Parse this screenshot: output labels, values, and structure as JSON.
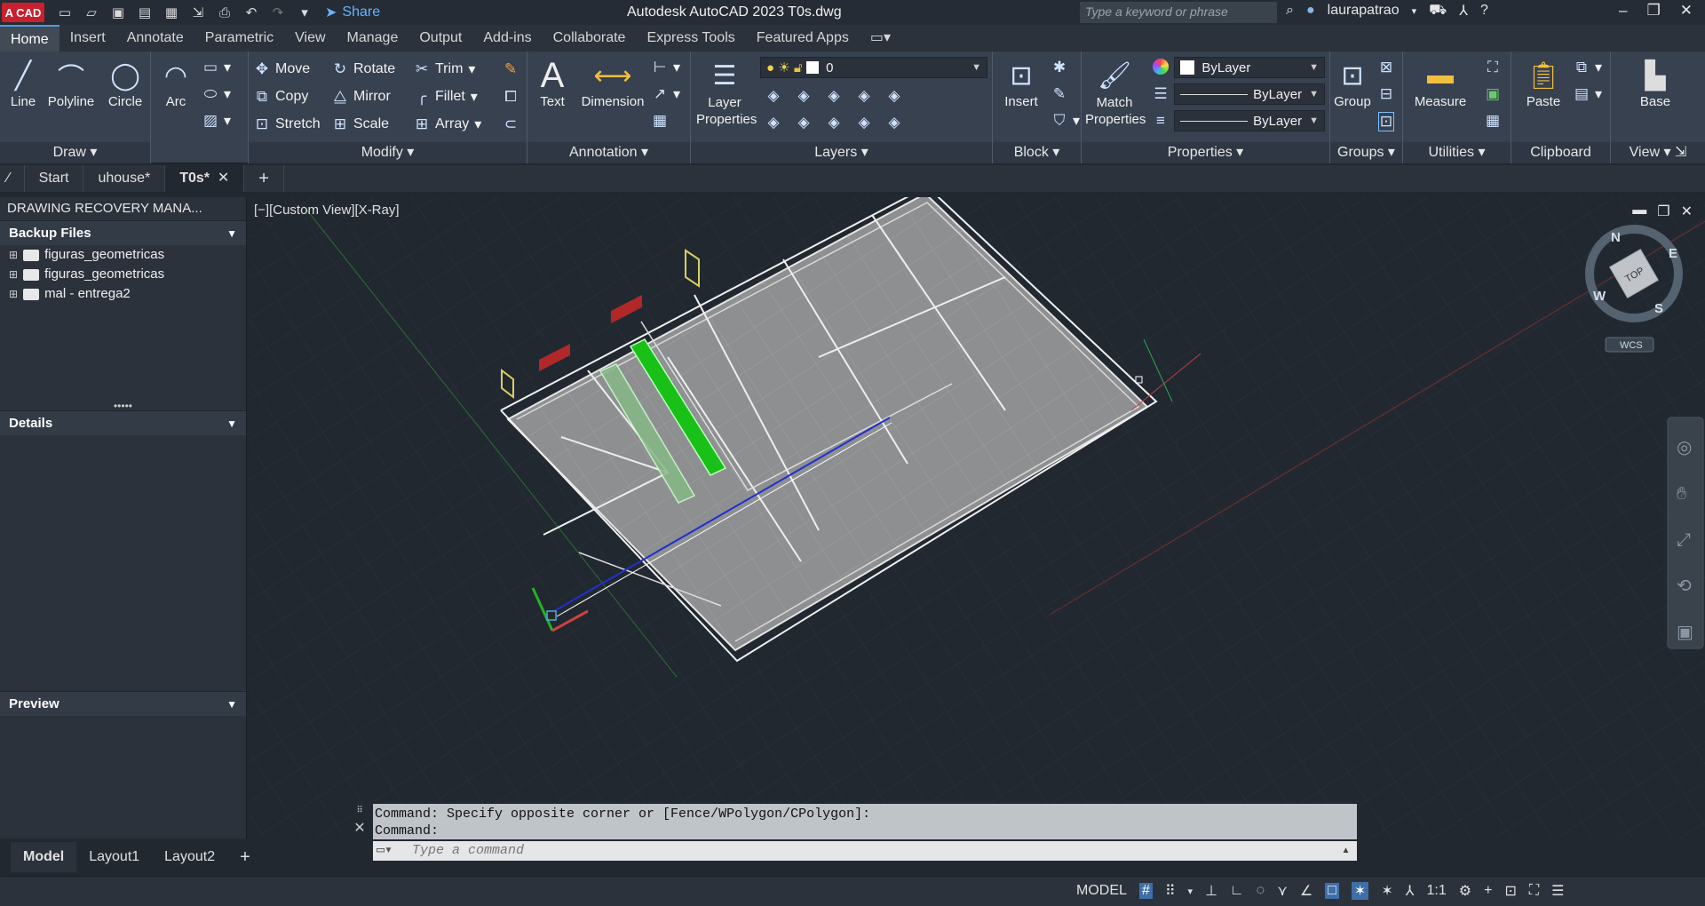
{
  "app": {
    "title": "Autodesk AutoCAD 2023  T0s.dwg",
    "logo": "A CAD",
    "share": "Share",
    "search_placeholder": "Type a keyword or phrase",
    "user": "laurapatrao"
  },
  "ribbon_tabs": [
    "Home",
    "Insert",
    "Annotate",
    "Parametric",
    "View",
    "Manage",
    "Output",
    "Add-ins",
    "Collaborate",
    "Express Tools",
    "Featured Apps"
  ],
  "draw": {
    "title": "Draw",
    "line": "Line",
    "polyline": "Polyline",
    "circle": "Circle",
    "arc": "Arc"
  },
  "modify": {
    "title": "Modify",
    "move": "Move",
    "rotate": "Rotate",
    "trim": "Trim",
    "copy": "Copy",
    "mirror": "Mirror",
    "fillet": "Fillet",
    "stretch": "Stretch",
    "scale": "Scale",
    "array": "Array"
  },
  "annotation": {
    "title": "Annotation",
    "text": "Text",
    "dimension": "Dimension"
  },
  "layers": {
    "title": "Layers",
    "properties": "Layer\nProperties",
    "current": "0"
  },
  "block": {
    "title": "Block",
    "insert": "Insert"
  },
  "properties": {
    "title": "Properties",
    "match": "Match\nProperties",
    "color": "ByLayer",
    "linetype": "ByLayer",
    "lineweight": "ByLayer"
  },
  "groups": {
    "title": "Groups",
    "group": "Group"
  },
  "utilities": {
    "title": "Utilities",
    "measure": "Measure"
  },
  "clipboard": {
    "title": "Clipboard",
    "paste": "Paste"
  },
  "view": {
    "title": "View",
    "base": "Base"
  },
  "doc_tabs": [
    "Start",
    "uhouse*",
    "T0s*"
  ],
  "recovery": {
    "header": "DRAWING RECOVERY MANA...",
    "backup": "Backup Files",
    "files": [
      "figuras_geometricas",
      "figuras_geometricas",
      "mal - entrega2"
    ],
    "details": "Details",
    "preview": "Preview"
  },
  "viewport": {
    "label": "[−][Custom View][X-Ray]",
    "viewcube": "TOP",
    "n": "N",
    "e": "E",
    "s": "S",
    "w": "W",
    "wcs": "WCS"
  },
  "command": {
    "line1": "Command: Specify opposite corner or [Fence/WPolygon/CPolygon]:",
    "line2": "Command:",
    "placeholder": "Type a command"
  },
  "layout_tabs": [
    "Model",
    "Layout1",
    "Layout2"
  ],
  "status": {
    "model": "MODEL",
    "scale": "1:1"
  }
}
